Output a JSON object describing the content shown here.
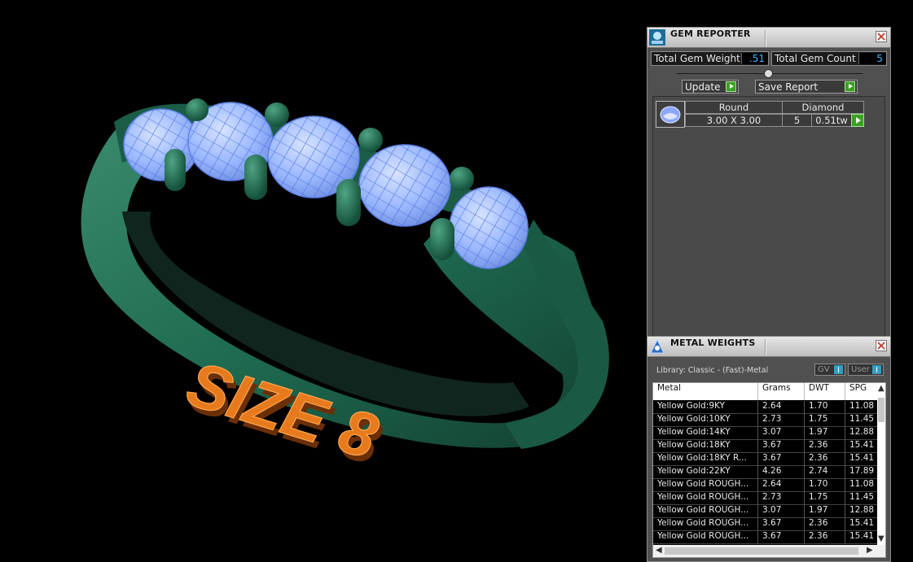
{
  "viewport": {
    "engraving_text": "SIZE 8",
    "colors": {
      "band": "#1f6b51",
      "gem": "#8fb3ff",
      "engraving": "#e87a1e",
      "background": "#000000"
    }
  },
  "gem_reporter": {
    "title": "GEM REPORTER",
    "icon": "gem-reporter-icon",
    "total_gem_weight_label": "Total Gem Weight",
    "total_gem_weight_value": ".51",
    "total_gem_count_label": "Total Gem Count",
    "total_gem_count_value": "5",
    "update_label": "Update",
    "save_report_label": "Save Report",
    "gems": [
      {
        "shape": "Round",
        "material": "Diamond",
        "size": "3.00 X 3.00",
        "count": "5",
        "weight": "0.51tw"
      }
    ]
  },
  "metal_weights": {
    "title": "METAL WEIGHTS",
    "icon": "metal-weights-icon",
    "library": "Library: Classic - (Fast)-Metal",
    "toggle_gv": "GV",
    "toggle_user": "User",
    "columns": [
      "Metal",
      "Grams",
      "DWT",
      "SPG"
    ],
    "rows": [
      [
        "Yellow Gold:9KY",
        "2.64",
        "1.70",
        "11.08"
      ],
      [
        "Yellow Gold:10KY",
        "2.73",
        "1.75",
        "11.45"
      ],
      [
        "Yellow Gold:14KY",
        "3.07",
        "1.97",
        "12.88"
      ],
      [
        "Yellow Gold:18KY",
        "3.67",
        "2.36",
        "15.41"
      ],
      [
        "Yellow Gold:18KY R...",
        "3.67",
        "2.36",
        "15.41"
      ],
      [
        "Yellow Gold:22KY",
        "4.26",
        "2.74",
        "17.89"
      ],
      [
        "Yellow Gold ROUGH...",
        "2.64",
        "1.70",
        "11.08"
      ],
      [
        "Yellow Gold ROUGH...",
        "2.73",
        "1.75",
        "11.45"
      ],
      [
        "Yellow Gold ROUGH...",
        "3.07",
        "1.97",
        "12.88"
      ],
      [
        "Yellow Gold ROUGH...",
        "3.67",
        "2.36",
        "15.41"
      ],
      [
        "Yellow Gold ROUGH...",
        "3.67",
        "2.36",
        "15.41"
      ]
    ]
  }
}
